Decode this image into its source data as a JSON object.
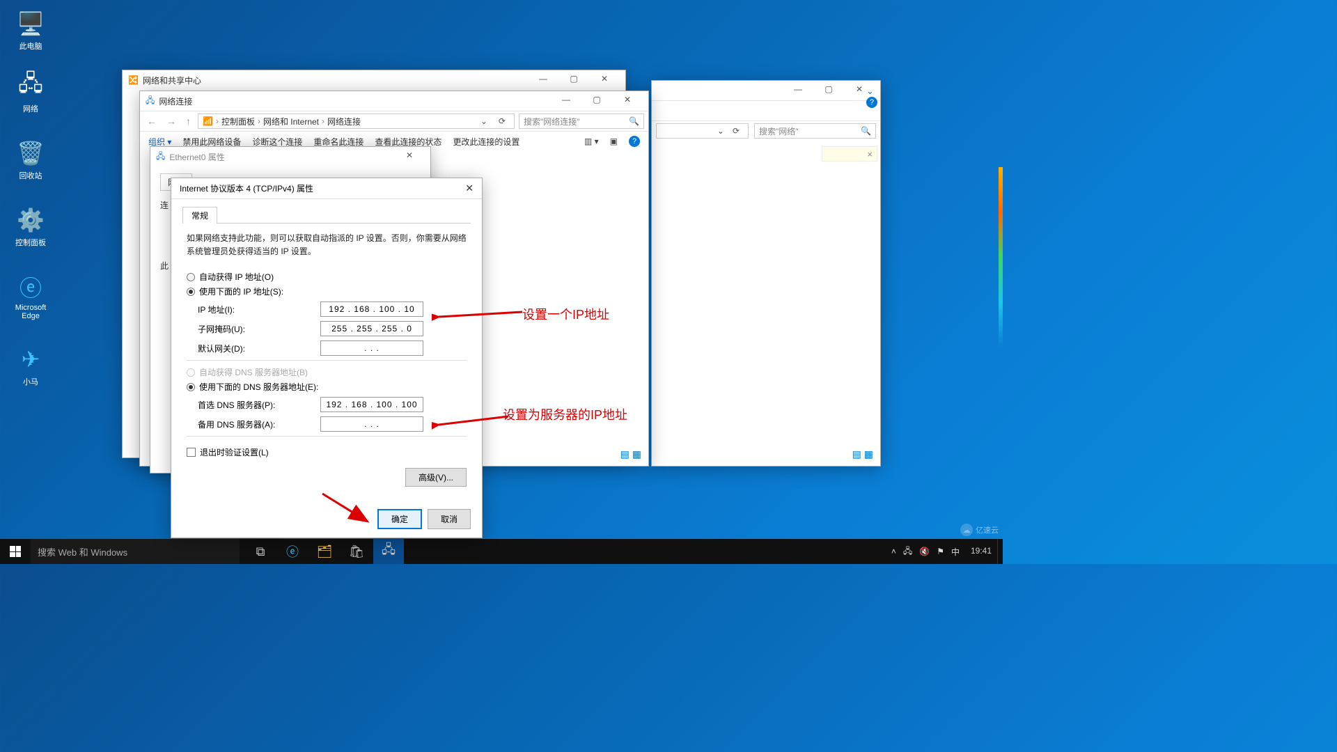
{
  "desktop": {
    "this_pc": "此电脑",
    "network": "网络",
    "recycle": "回收站",
    "cpanel": "控制面板",
    "edge": "Microsoft Edge",
    "xiaoma": "小马"
  },
  "win_nsc": {
    "title": "网络和共享中心"
  },
  "win_shell": {
    "search_placeholder": "搜索\"网络\"",
    "close_x": "×"
  },
  "win_nc": {
    "title": "网络连接",
    "crumbs": [
      "控制面板",
      "网络和 Internet",
      "网络连接"
    ],
    "search_placeholder": "搜索\"网络连接\"",
    "cmdbar": {
      "organize": "组织 ▾",
      "disable": "禁用此网络设备",
      "diagnose": "诊断这个连接",
      "rename": "重命名此连接",
      "status": "查看此连接的状态",
      "change": "更改此连接的设置"
    }
  },
  "win_ethprop": {
    "title": "Ethernet0 属性",
    "net_label": "网络",
    "connect_label": "连",
    "this_label": "此"
  },
  "ipv4": {
    "title": "Internet 协议版本 4 (TCP/IPv4) 属性",
    "tab": "常规",
    "desc": "如果网络支持此功能，则可以获取自动指派的 IP 设置。否则，你需要从网络系统管理员处获得适当的 IP 设置。",
    "radio_auto_ip": "自动获得 IP 地址(O)",
    "radio_manual_ip": "使用下面的 IP 地址(S):",
    "lbl_ip": "IP 地址(I):",
    "lbl_mask": "子网掩码(U):",
    "lbl_gw": "默认网关(D):",
    "val_ip": "192 . 168 . 100 .  10",
    "val_mask": "255 . 255 . 255 .   0",
    "val_gw": ".        .        .",
    "radio_auto_dns": "自动获得 DNS 服务器地址(B)",
    "radio_manual_dns": "使用下面的 DNS 服务器地址(E):",
    "lbl_dns1": "首选 DNS 服务器(P):",
    "lbl_dns2": "备用 DNS 服务器(A):",
    "val_dns1": "192 . 168 . 100 . 100",
    "val_dns2": ".        .        .",
    "chk_exit": "退出时验证设置(L)",
    "btn_adv": "高级(V)...",
    "btn_ok": "确定",
    "btn_cancel": "取消"
  },
  "annot": {
    "a1": "设置一个IP地址",
    "a2": "设置为服务器的IP地址"
  },
  "taskbar": {
    "search": "搜索 Web 和 Windows",
    "clock": "19:41",
    "ime": "中"
  },
  "watermark": "亿速云"
}
